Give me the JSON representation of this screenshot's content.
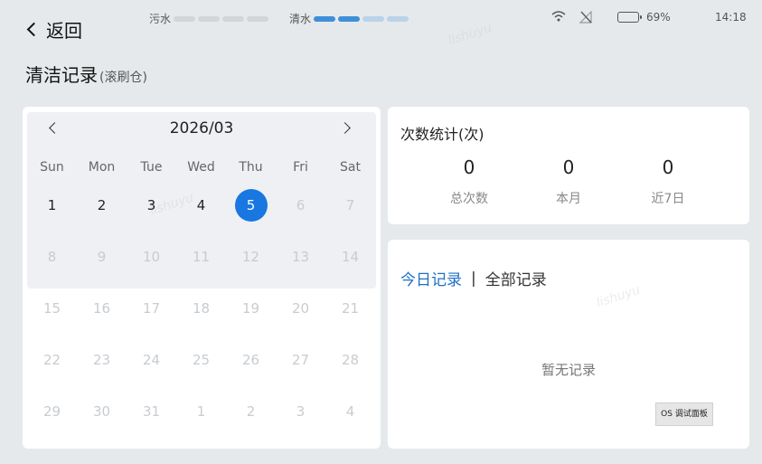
{
  "status_bar": {
    "back_label": "返回",
    "dirty_water_label": "污水",
    "clean_water_label": "清水",
    "dirty_water_level": [
      0,
      0,
      0,
      0
    ],
    "clean_water_level": [
      1,
      1,
      0.5,
      0.5
    ],
    "battery_percent": "69%",
    "battery_level": 0.69,
    "time": "14:18"
  },
  "page": {
    "title": "清洁记录",
    "subtitle": "(滚刷仓)"
  },
  "calendar": {
    "month": "2026/03",
    "weekdays": [
      "Sun",
      "Mon",
      "Tue",
      "Wed",
      "Thu",
      "Fri",
      "Sat"
    ],
    "selected_day": "5",
    "weeks": [
      [
        {
          "d": "1",
          "m": false
        },
        {
          "d": "2",
          "m": false
        },
        {
          "d": "3",
          "m": false
        },
        {
          "d": "4",
          "m": false
        },
        {
          "d": "5",
          "m": false,
          "s": true
        },
        {
          "d": "6",
          "m": true
        },
        {
          "d": "7",
          "m": true
        }
      ],
      [
        {
          "d": "8",
          "m": true
        },
        {
          "d": "9",
          "m": true
        },
        {
          "d": "10",
          "m": true
        },
        {
          "d": "11",
          "m": true
        },
        {
          "d": "12",
          "m": true
        },
        {
          "d": "13",
          "m": true
        },
        {
          "d": "14",
          "m": true
        }
      ],
      [
        {
          "d": "15",
          "m": true
        },
        {
          "d": "16",
          "m": true
        },
        {
          "d": "17",
          "m": true
        },
        {
          "d": "18",
          "m": true
        },
        {
          "d": "19",
          "m": true
        },
        {
          "d": "20",
          "m": true
        },
        {
          "d": "21",
          "m": true
        }
      ],
      [
        {
          "d": "22",
          "m": true
        },
        {
          "d": "23",
          "m": true
        },
        {
          "d": "24",
          "m": true
        },
        {
          "d": "25",
          "m": true
        },
        {
          "d": "26",
          "m": true
        },
        {
          "d": "27",
          "m": true
        },
        {
          "d": "28",
          "m": true
        }
      ],
      [
        {
          "d": "29",
          "m": true
        },
        {
          "d": "30",
          "m": true
        },
        {
          "d": "31",
          "m": true
        },
        {
          "d": "1",
          "m": true
        },
        {
          "d": "2",
          "m": true
        },
        {
          "d": "3",
          "m": true
        },
        {
          "d": "4",
          "m": true
        }
      ]
    ]
  },
  "stats": {
    "title": "次数统计(次)",
    "items": [
      {
        "value": "0",
        "label": "总次数"
      },
      {
        "value": "0",
        "label": "本月"
      },
      {
        "value": "0",
        "label": "近7日"
      }
    ]
  },
  "records": {
    "tab_today": "今日记录",
    "separator": "|",
    "tab_all": "全部记录",
    "empty_text": "暂无记录",
    "debug_button": "OS 调试面板"
  },
  "colors": {
    "accent": "#1877e0",
    "tab_active": "#1e6fc4",
    "background": "#e6e9ec"
  }
}
